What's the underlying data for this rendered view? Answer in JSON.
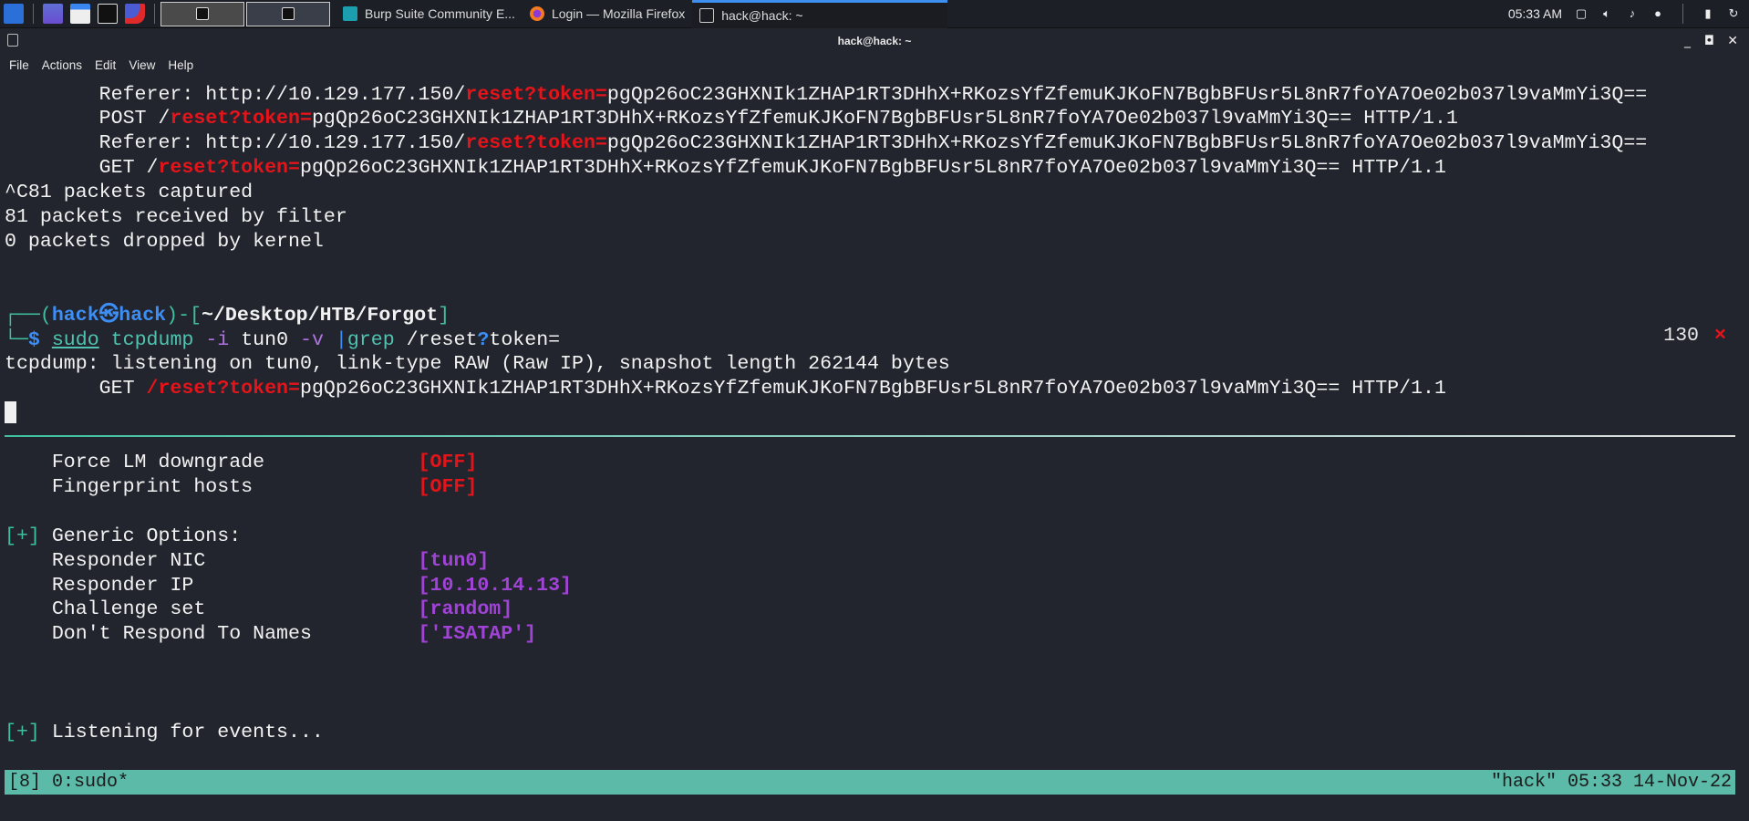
{
  "taskbar": {
    "tasks": [
      {
        "label": "Burp Suite Community E...",
        "icon": "burp-icon"
      },
      {
        "label": "Login — Mozilla Firefox",
        "icon": "firefox-icon"
      },
      {
        "label": "hack@hack: ~",
        "icon": "terminal-icon",
        "active": true
      }
    ],
    "clock": "05:33 AM",
    "accent": "#3d8ff0"
  },
  "window": {
    "title": "hack@hack: ~"
  },
  "menu": [
    "File",
    "Actions",
    "Edit",
    "View",
    "Help"
  ],
  "terminal": {
    "colors": {
      "background": "#23252e",
      "red": "#e5141a",
      "teal": "#3fbfa0",
      "blue": "#3c8ef5",
      "purple": "#a043d6"
    },
    "lines": [
      {
        "row": 0,
        "segs": [
          {
            "t": "        Referer: http://10.129.177.150/",
            "c": "white"
          },
          {
            "t": "reset?token=",
            "c": "red"
          },
          {
            "t": "pgQp26oC23GHXNIk1ZHAP1RT3DHhX+RKozsYfZfemuKJKoFN7BgbBFUsr5L8nR7foYA7Oe02b037l9vaMmYi3Q==",
            "c": "white"
          }
        ]
      },
      {
        "row": 1,
        "segs": [
          {
            "t": "        POST /",
            "c": "white"
          },
          {
            "t": "reset?token=",
            "c": "red"
          },
          {
            "t": "pgQp26oC23GHXNIk1ZHAP1RT3DHhX+RKozsYfZfemuKJKoFN7BgbBFUsr5L8nR7foYA7Oe02b037l9vaMmYi3Q== HTTP/1.1",
            "c": "white"
          }
        ]
      },
      {
        "row": 2,
        "segs": [
          {
            "t": "        Referer: http://10.129.177.150/",
            "c": "white"
          },
          {
            "t": "reset?token=",
            "c": "red"
          },
          {
            "t": "pgQp26oC23GHXNIk1ZHAP1RT3DHhX+RKozsYfZfemuKJKoFN7BgbBFUsr5L8nR7foYA7Oe02b037l9vaMmYi3Q==",
            "c": "white"
          }
        ]
      },
      {
        "row": 3,
        "segs": [
          {
            "t": "        GET /",
            "c": "white"
          },
          {
            "t": "reset?token=",
            "c": "red"
          },
          {
            "t": "pgQp26oC23GHXNIk1ZHAP1RT3DHhX+RKozsYfZfemuKJKoFN7BgbBFUsr5L8nR7foYA7Oe02b037l9vaMmYi3Q== HTTP/1.1",
            "c": "white"
          }
        ]
      },
      {
        "row": 4,
        "segs": [
          {
            "t": "^C81 packets captured",
            "c": "white"
          }
        ]
      },
      {
        "row": 5,
        "segs": [
          {
            "t": "81 packets received by filter",
            "c": "white"
          }
        ]
      },
      {
        "row": 6,
        "segs": [
          {
            "t": "0 packets dropped by kernel",
            "c": "white"
          }
        ]
      },
      {
        "row": 9,
        "segs": [
          {
            "t": "┌──(",
            "c": "teal"
          },
          {
            "t": "hack㉿hack",
            "c": "blue"
          },
          {
            "t": ")-[",
            "c": "teal"
          },
          {
            "t": "~/Desktop/HTB/Forgot",
            "c": "white bold"
          },
          {
            "t": "]",
            "c": "teal"
          }
        ]
      },
      {
        "row": 10,
        "segs": [
          {
            "t": "└─",
            "c": "teal"
          },
          {
            "t": "$ ",
            "c": "blue"
          },
          {
            "t": "sudo",
            "c": "green ul"
          },
          {
            "t": " tcpdump",
            "c": "green"
          },
          {
            "t": " -i",
            "c": "dim"
          },
          {
            "t": " tun0",
            "c": "white"
          },
          {
            "t": " -v",
            "c": "dim"
          },
          {
            "t": " |",
            "c": "bar"
          },
          {
            "t": "grep",
            "c": "green"
          },
          {
            "t": " /reset",
            "c": "white"
          },
          {
            "t": "?",
            "c": "blue"
          },
          {
            "t": "token=",
            "c": "white"
          }
        ]
      },
      {
        "row": 11,
        "segs": [
          {
            "t": "tcpdump: listening on tun0, link-type RAW (Raw IP), snapshot length 262144 bytes",
            "c": "white"
          }
        ]
      },
      {
        "row": 12,
        "segs": [
          {
            "t": "        GET ",
            "c": "white"
          },
          {
            "t": "/reset?token=",
            "c": "red"
          },
          {
            "t": "pgQp26oC23GHXNIk1ZHAP1RT3DHhX+RKozsYfZfemuKJKoFN7BgbBFUsr5L8nR7foYA7Oe02b037l9vaMmYi3Q== HTTP/1.1",
            "c": "white"
          }
        ]
      },
      {
        "row": 15,
        "segs": [
          {
            "t": "    Force LM downgrade             ",
            "c": "white"
          },
          {
            "t": "[OFF]",
            "c": "red"
          }
        ]
      },
      {
        "row": 16,
        "segs": [
          {
            "t": "    Fingerprint hosts              ",
            "c": "white"
          },
          {
            "t": "[OFF]",
            "c": "red"
          }
        ]
      },
      {
        "row": 18,
        "segs": [
          {
            "t": "[+]",
            "c": "teal"
          },
          {
            "t": " Generic Options:",
            "c": "white"
          }
        ]
      },
      {
        "row": 19,
        "segs": [
          {
            "t": "    Responder NIC                  ",
            "c": "white"
          },
          {
            "t": "[tun0]",
            "c": "purple"
          }
        ]
      },
      {
        "row": 20,
        "segs": [
          {
            "t": "    Responder IP                   ",
            "c": "white"
          },
          {
            "t": "[10.10.14.13]",
            "c": "purple"
          }
        ]
      },
      {
        "row": 21,
        "segs": [
          {
            "t": "    Challenge set                  ",
            "c": "white"
          },
          {
            "t": "[random]",
            "c": "purple"
          }
        ]
      },
      {
        "row": 22,
        "segs": [
          {
            "t": "    Don't Respond To Names         ",
            "c": "white"
          },
          {
            "t": "['ISATAP']",
            "c": "purple"
          }
        ]
      },
      {
        "row": 26,
        "segs": [
          {
            "t": "[+]",
            "c": "teal"
          },
          {
            "t": " Listening for events...",
            "c": "white"
          }
        ]
      }
    ],
    "exit_code": "130",
    "exit_mark": "×"
  },
  "tmux": {
    "left": "[8] 0:sudo*",
    "right": "\"hack\" 05:33 14-Nov-22",
    "color": "#5cbaa8"
  }
}
